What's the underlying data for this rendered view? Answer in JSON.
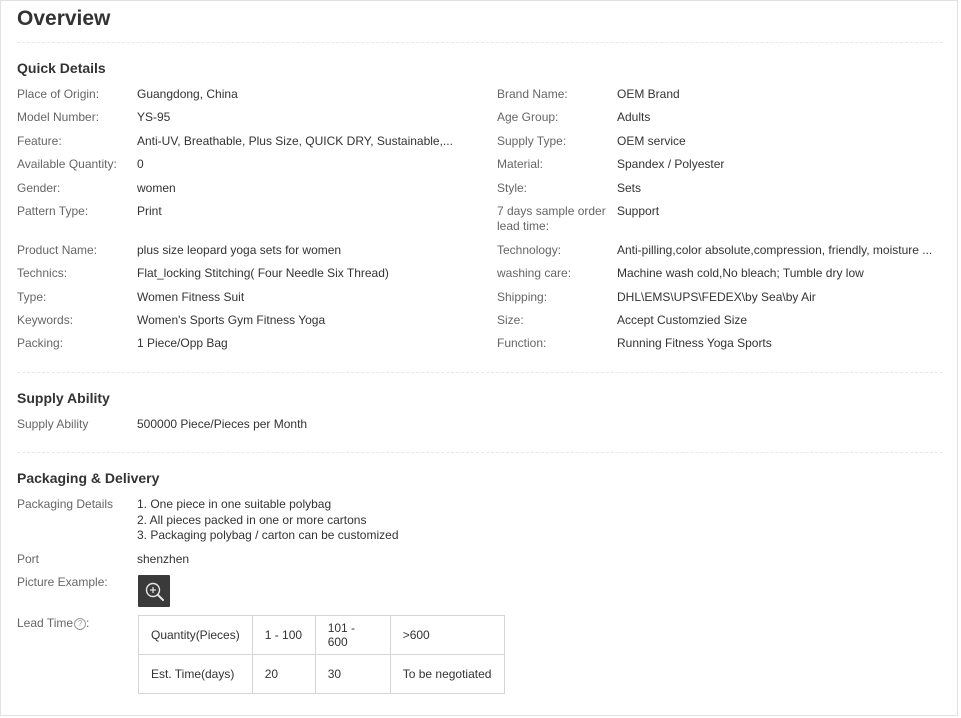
{
  "overview_title": "Overview",
  "quick_details": {
    "title": "Quick Details",
    "rows": [
      {
        "l1": "Place of Origin:",
        "v1": "Guangdong, China",
        "l2": "Brand Name:",
        "v2": "OEM Brand"
      },
      {
        "l1": "Model Number:",
        "v1": "YS-95",
        "l2": "Age Group:",
        "v2": "Adults"
      },
      {
        "l1": "Feature:",
        "v1": "Anti-UV, Breathable, Plus Size, QUICK DRY, Sustainable,...",
        "l2": "Supply Type:",
        "v2": "OEM service"
      },
      {
        "l1": "Available Quantity:",
        "v1": "0",
        "l2": "Material:",
        "v2": "Spandex / Polyester"
      },
      {
        "l1": "Gender:",
        "v1": "women",
        "l2": "Style:",
        "v2": "Sets"
      },
      {
        "l1": "Pattern Type:",
        "v1": "Print",
        "l2": "7 days sample order lead time:",
        "v2": "Support"
      },
      {
        "l1": "Product Name:",
        "v1": "plus size leopard yoga sets for women",
        "l2": "Technology:",
        "v2": "Anti-pilling,color absolute,compression, friendly, moisture ..."
      },
      {
        "l1": "Technics:",
        "v1": "Flat_locking Stitching( Four Needle Six Thread)",
        "l2": "washing care:",
        "v2": "Machine wash cold,No bleach; Tumble dry low"
      },
      {
        "l1": "Type:",
        "v1": "Women Fitness Suit",
        "l2": "Shipping:",
        "v2": "DHL\\EMS\\UPS\\FEDEX\\by Sea\\by Air"
      },
      {
        "l1": "Keywords:",
        "v1": "Women's Sports Gym Fitness Yoga",
        "l2": "Size:",
        "v2": "Accept Customzied Size"
      },
      {
        "l1": "Packing:",
        "v1": "1 Piece/Opp Bag",
        "l2": "Function:",
        "v2": "Running Fitness Yoga Sports"
      }
    ]
  },
  "supply_ability": {
    "title": "Supply Ability",
    "label": "Supply Ability",
    "value": "500000 Piece/Pieces per Month"
  },
  "packaging": {
    "title": "Packaging & Delivery",
    "details_label": "Packaging Details",
    "details_lines": [
      "1. One piece in one suitable polybag",
      "2. All pieces packed in one or more cartons",
      "3. Packaging polybag / carton can be customized"
    ],
    "port_label": "Port",
    "port_value": "shenzhen",
    "picture_label": "Picture Example:",
    "picture_icon": "zoom-in-icon",
    "lead_time_label": "Lead Time",
    "lead_time_suffix": ":",
    "help_icon": "?",
    "lead_time_table": {
      "header": [
        "Quantity(Pieces)",
        "1 - 100",
        "101 - 600",
        ">600"
      ],
      "row": [
        "Est. Time(days)",
        "20",
        "30",
        "To be negotiated"
      ]
    }
  }
}
